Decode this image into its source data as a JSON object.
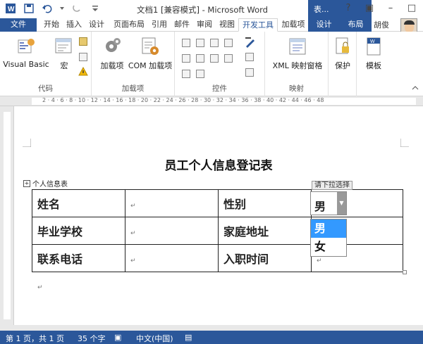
{
  "title_bar": {
    "doc_title": "文档1 [兼容模式] - Microsoft Word",
    "context_tab_title": "表..."
  },
  "tabs": [
    "文件",
    "开始",
    "插入",
    "设计",
    "页面布局",
    "引用",
    "邮件",
    "审阅",
    "视图",
    "开发工具",
    "加载项",
    "设计",
    "布局"
  ],
  "active_tab": "开发工具",
  "user_name": "胡俊",
  "ribbon": {
    "code_group": {
      "label": "代码",
      "visual_basic": "Visual Basic",
      "macro": "宏"
    },
    "addins_group": {
      "label": "加载项",
      "addins": "加载项",
      "com_addins": "COM 加载项"
    },
    "controls_group": {
      "label": "控件"
    },
    "mapping_group": {
      "label": "映射",
      "xml_pane": "XML 映射窗格"
    },
    "protect_group": {
      "protect": "保护"
    },
    "template_group": {
      "template": "模板"
    }
  },
  "ruler": {
    "numbers": "2 · 4 · 6 · 8 · 10 · 12 · 14 · 16 · 18 · 20 · 22 · 24 · 26 · 28 · 30 · 32 · 34 · 36 · 38 · 40 · 42 · 44 · 46 · 48"
  },
  "document": {
    "heading": "员工个人信息登记表",
    "table_caption": "个人信息表",
    "rows": [
      [
        "姓名",
        "",
        "性别",
        "男"
      ],
      [
        "毕业学校",
        "",
        "家庭地址",
        ""
      ],
      [
        "联系电话",
        "",
        "入职时间",
        ""
      ]
    ],
    "dropdown": {
      "title": "请下拉选择",
      "value": "男",
      "options": [
        "男",
        "女"
      ],
      "selected": "男"
    }
  },
  "status_bar": {
    "page": "第 1 页，共 1 页",
    "words": "35 个字",
    "language": "中文(中国)"
  }
}
